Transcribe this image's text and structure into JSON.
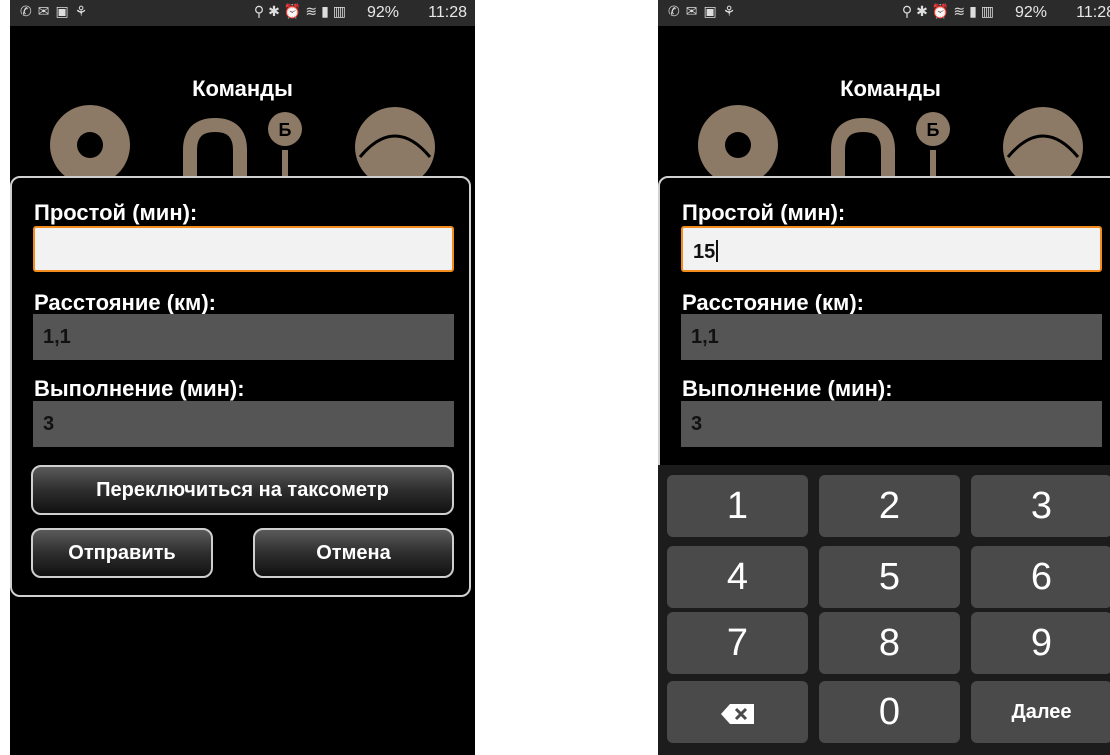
{
  "status_bar": {
    "left_icons": [
      "whatsapp-icon",
      "gmail-icon",
      "gallery-icon",
      "car-icon"
    ],
    "right_icons": [
      "location-icon",
      "bluetooth-icon",
      "alarm-icon",
      "wifi-icon",
      "sim-icon",
      "signal-icon"
    ],
    "battery": "92%",
    "time": "11:28"
  },
  "screen": {
    "title": "Команды"
  },
  "dialog": {
    "downtime_label": "Простой (мин):",
    "distance_label": "Расстояние (км):",
    "execution_label": "Выполнение (мин):",
    "switch_button": "Переключиться на таксометр",
    "send_button": "Отправить",
    "cancel_button": "Отмена"
  },
  "left": {
    "downtime_value": "",
    "distance_value": "1,1",
    "execution_value": "3"
  },
  "right": {
    "downtime_value": "15",
    "distance_value": "1,1",
    "execution_value": "3"
  },
  "keyboard": {
    "keys": [
      "1",
      "2",
      "3",
      "4",
      "5",
      "6",
      "7",
      "8",
      "9",
      "0"
    ],
    "backspace_icon": "backspace-icon",
    "next_label": "Далее"
  },
  "colors": {
    "active_border": "#f28c1d",
    "icon_fill": "#8c7a66",
    "readonly_bg": "#555555"
  }
}
